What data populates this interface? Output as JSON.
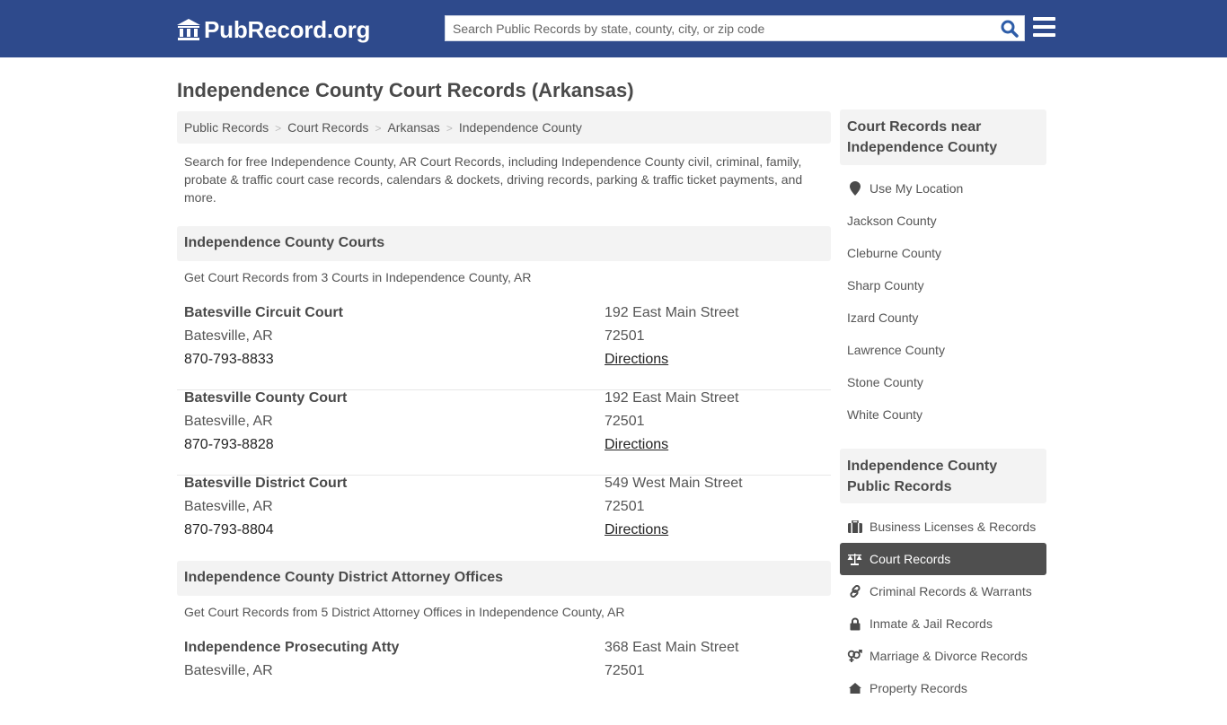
{
  "header": {
    "logo_text": "PubRecord.org",
    "search_placeholder": "Search Public Records by state, county, city, or zip code",
    "brand_color": "#2e4a8c"
  },
  "page": {
    "title": "Independence County Court Records (Arkansas)",
    "breadcrumb": [
      "Public Records",
      "Court Records",
      "Arkansas",
      "Independence County"
    ],
    "intro": "Search for free Independence County, AR Court Records, including Independence County civil, criminal, family, probate & traffic court case records, calendars & dockets, driving records, parking & traffic ticket payments, and more."
  },
  "courts": {
    "heading": "Independence County Courts",
    "subtitle": "Get Court Records from 3 Courts in Independence County, AR",
    "items": [
      {
        "name": "Batesville Circuit Court",
        "city": "Batesville, AR",
        "phone": "870-793-8833",
        "address": "192 East Main Street",
        "zip": "72501",
        "link": "Directions"
      },
      {
        "name": "Batesville County Court",
        "city": "Batesville, AR",
        "phone": "870-793-8828",
        "address": "192 East Main Street",
        "zip": "72501",
        "link": "Directions"
      },
      {
        "name": "Batesville District Court",
        "city": "Batesville, AR",
        "phone": "870-793-8804",
        "address": "549 West Main Street",
        "zip": "72501",
        "link": "Directions"
      }
    ]
  },
  "attorneys": {
    "heading": "Independence County District Attorney Offices",
    "subtitle": "Get Court Records from 5 District Attorney Offices in Independence County, AR",
    "items": [
      {
        "name": "Independence Prosecuting Atty",
        "city": "Batesville, AR",
        "address": "368 East Main Street",
        "zip": "72501"
      }
    ]
  },
  "sidebar": {
    "nearby_heading": "Court Records near Independence County",
    "use_location": "Use My Location",
    "nearby": [
      "Jackson County",
      "Cleburne County",
      "Sharp County",
      "Izard County",
      "Lawrence County",
      "Stone County",
      "White County"
    ],
    "records_heading": "Independence County Public Records",
    "records": [
      {
        "label": "Business Licenses & Records",
        "icon": "briefcase-icon",
        "active": false
      },
      {
        "label": "Court Records",
        "icon": "balance-scale-icon",
        "active": true
      },
      {
        "label": "Criminal Records & Warrants",
        "icon": "link-icon",
        "active": false
      },
      {
        "label": "Inmate & Jail Records",
        "icon": "lock-icon",
        "active": false
      },
      {
        "label": "Marriage & Divorce Records",
        "icon": "gender-icon",
        "active": false
      },
      {
        "label": "Property Records",
        "icon": "home-icon",
        "active": false
      }
    ]
  }
}
